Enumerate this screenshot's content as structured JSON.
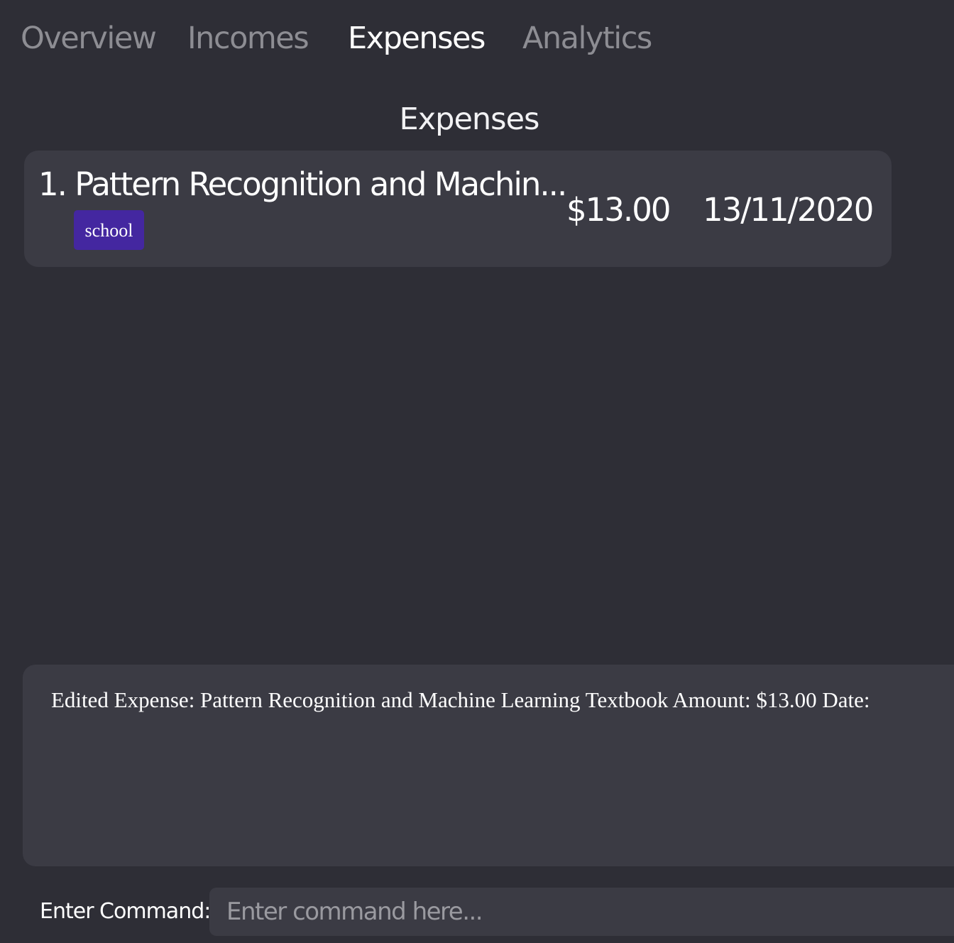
{
  "tabs": {
    "overview": "Overview",
    "incomes": "Incomes",
    "expenses": "Expenses",
    "analytics": "Analytics",
    "active": "Expenses"
  },
  "main": {
    "section_title": "Expenses",
    "expenses": [
      {
        "title": "1. Pattern Recognition and Machin...",
        "tag": "school",
        "amount": "$13.00",
        "date": "13/11/2020"
      }
    ]
  },
  "result": {
    "message": "Edited Expense: Pattern Recognition and Machine Learning Textbook Amount: $13.00 Date:"
  },
  "command": {
    "label": "Enter Command:",
    "placeholder": "Enter command here..."
  },
  "colors": {
    "background": "#2e2e36",
    "panel": "#3b3b44",
    "tag": "#4427a0",
    "inactive_tab": "#8d8d93"
  }
}
